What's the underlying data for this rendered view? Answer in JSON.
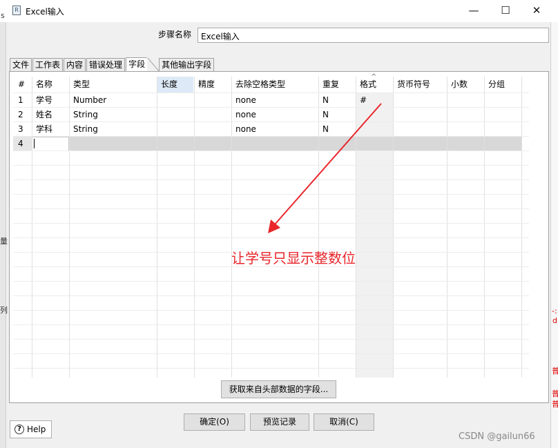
{
  "window": {
    "title": "Excel输入",
    "minimize_glyph": "—",
    "maximize_glyph": "☐",
    "close_glyph": "✕",
    "app_icon_glyph": "R"
  },
  "background_fragments": {
    "left_1": "s",
    "left_2": "量",
    "left_3": "列",
    "right_1": "-:",
    "right_2": "d",
    "right_3": "普",
    "right_4": "普",
    "right_5": "普"
  },
  "step": {
    "label": "步骤名称",
    "value": "Excel输入"
  },
  "tabs": [
    {
      "label": "文件"
    },
    {
      "label": "工作表"
    },
    {
      "label": "内容"
    },
    {
      "label": "错误处理"
    },
    {
      "label": "字段",
      "active": true
    },
    {
      "label": "其他输出字段"
    }
  ],
  "table": {
    "sort_indicator": "^",
    "headers": [
      "#",
      "名称",
      "类型",
      "长度",
      "精度",
      "去除空格类型",
      "重复",
      "格式",
      "货币符号",
      "小数",
      "分组"
    ],
    "rows": [
      {
        "num": "1",
        "name": "学号",
        "type": "Number",
        "trim": "none",
        "repeat": "N",
        "format": "#"
      },
      {
        "num": "2",
        "name": "姓名",
        "type": "String",
        "trim": "none",
        "repeat": "N",
        "format": ""
      },
      {
        "num": "3",
        "name": "学科",
        "type": "String",
        "trim": "none",
        "repeat": "N",
        "format": ""
      },
      {
        "num": "4",
        "name": "",
        "type": "",
        "trim": "",
        "repeat": "",
        "format": ""
      }
    ]
  },
  "buttons": {
    "fetch_fields": "获取来自头部数据的字段...",
    "help": "Help",
    "ok": "确定(O)",
    "preview": "预览记录",
    "cancel": "取消(C)"
  },
  "annotation": {
    "text": "让学号只显示整数位",
    "color": "#e8262b"
  },
  "watermark": "CSDN @gailun66"
}
